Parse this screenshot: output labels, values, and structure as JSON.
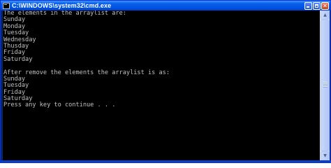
{
  "window": {
    "title": "C:\\WINDOWS\\system32\\cmd.exe",
    "icon": "cmd-icon"
  },
  "console": {
    "lines": [
      "The elements in the arraylist are:",
      "Sunday",
      "Monday",
      "Tuesday",
      "Wednesday",
      "Thusday",
      "Friday",
      "Saturday",
      "",
      "After remove the elements the arraylist is as:",
      "Sunday",
      "Tuesday",
      "Friday",
      "Saturday",
      "Press any key to continue . . ."
    ]
  },
  "colors": {
    "titlebar": "#0054e3",
    "console_background": "#000000",
    "console_text": "#c0c0c0"
  }
}
